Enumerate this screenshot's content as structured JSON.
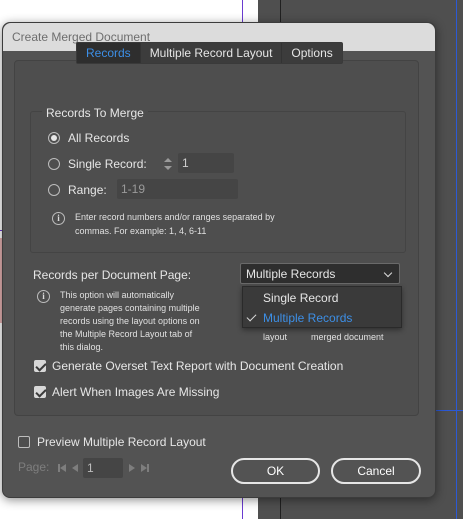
{
  "dialog": {
    "title": "Create Merged Document"
  },
  "tabs": [
    {
      "label": "Records"
    },
    {
      "label": "Multiple Record Layout"
    },
    {
      "label": "Options"
    }
  ],
  "records_to_merge": {
    "heading": "Records To Merge",
    "all_records_label": "All Records",
    "single_record_label": "Single Record:",
    "single_record_value": "1",
    "range_label": "Range:",
    "range_placeholder": "1-19",
    "note_line1": "Enter record numbers and/or ranges separated by",
    "note_line2": "commas. For example: 1, 4, 6-11"
  },
  "per_page": {
    "label": "Records per Document Page:",
    "selected": "Multiple Records",
    "options": [
      "Single Record",
      "Multiple Records"
    ],
    "info_line1": "This option will automatically",
    "info_line2": "generate pages containing multiple",
    "info_line3": "records using the layout options on",
    "info_line4": "the Multiple Record Layout tab of",
    "info_line5": "this dialog.",
    "partial_left": "layout",
    "partial_right": "merged document"
  },
  "checkboxes": {
    "overset_report": "Generate Overset Text Report with Document Creation",
    "images_missing": "Alert When Images Are Missing",
    "preview_layout": "Preview Multiple Record Layout"
  },
  "pager": {
    "label": "Page:",
    "value": "1"
  },
  "buttons": {
    "ok": "OK",
    "cancel": "Cancel"
  },
  "colors": {
    "accent": "#3d8fe6",
    "dialog_bg": "#535353"
  }
}
